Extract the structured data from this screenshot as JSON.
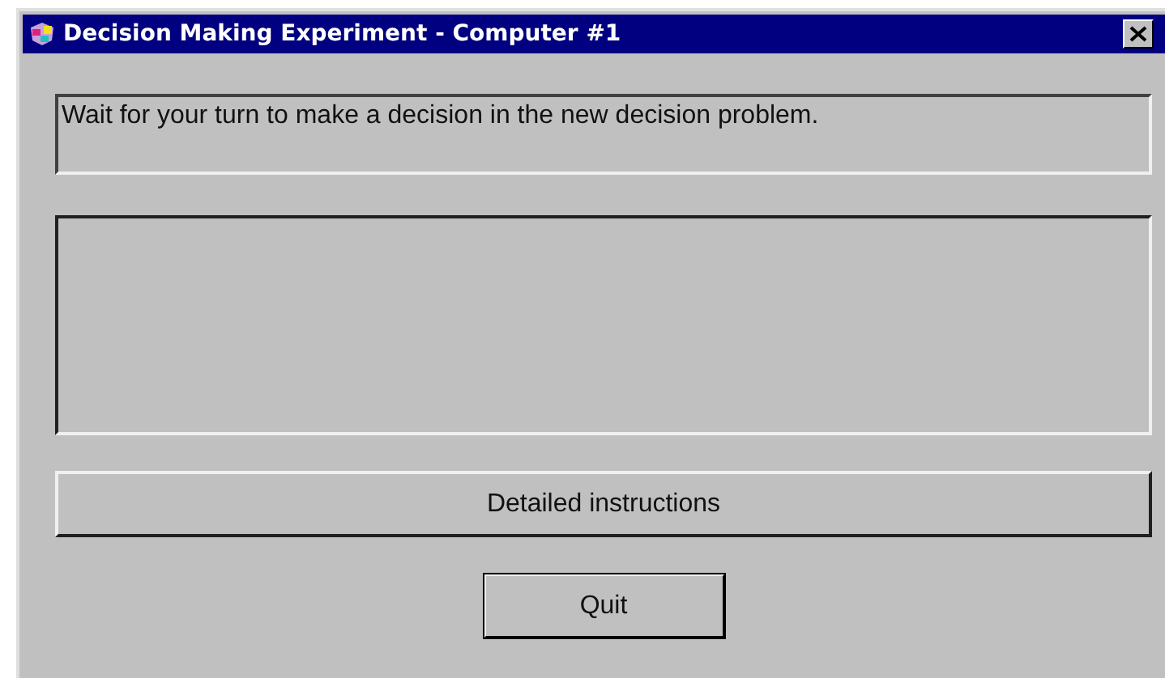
{
  "window": {
    "title": "Decision Making Experiment - Computer #1"
  },
  "message": "Wait for your turn to make a decision in the new decision problem.",
  "buttons": [
    "Detailed instructions",
    "Quit"
  ]
}
